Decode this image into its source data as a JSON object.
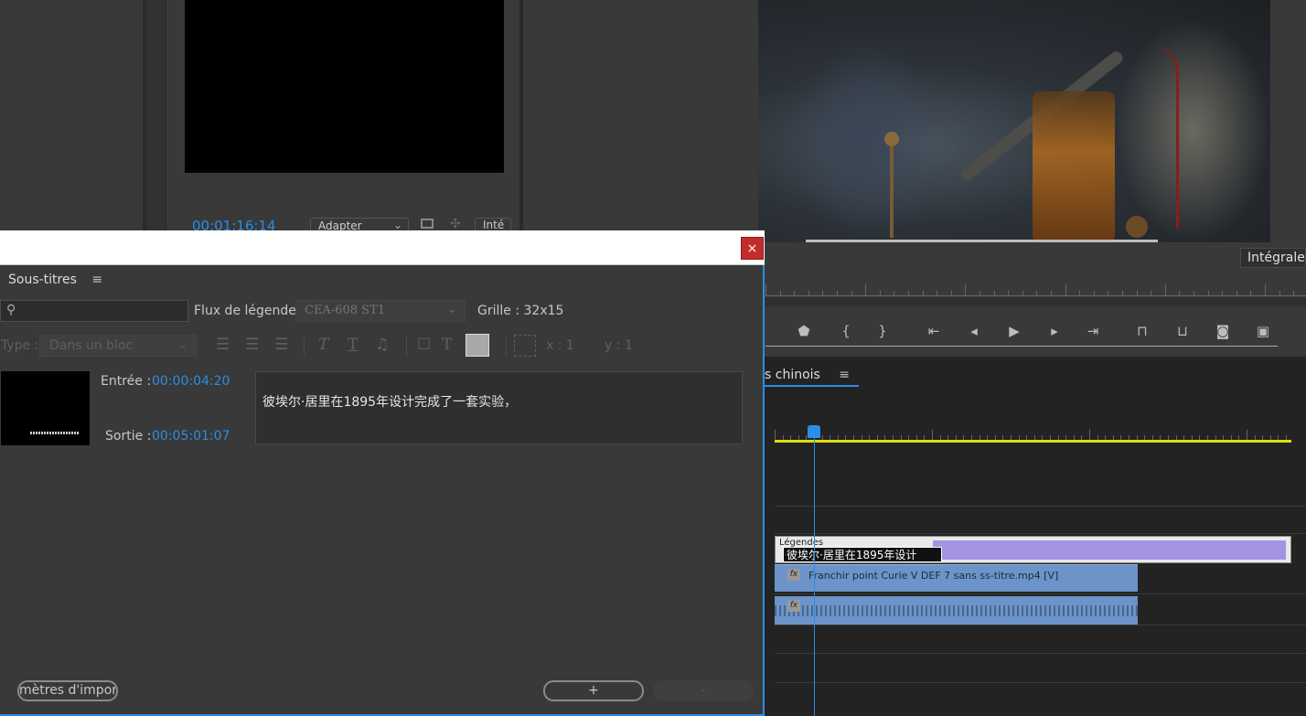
{
  "source_monitor": {
    "timecode": "00:01:16:14",
    "fit_value": "Adapter",
    "quality_value": "Inté"
  },
  "program_monitor": {
    "quality_value": "Intégrale"
  },
  "transport": {
    "buttons": [
      "marker-icon",
      "mark-in-icon",
      "mark-out-icon",
      "go-to-in-icon",
      "step-back-icon",
      "play-icon",
      "step-forward-icon",
      "go-to-out-icon",
      "lift-icon",
      "extract-icon",
      "export-frame-icon",
      "button-editor-icon"
    ]
  },
  "timeline": {
    "tab_label": "s chinois",
    "menu_icon": "≡",
    "caption_track_label": "Légendes",
    "caption_clip_text": "彼埃尔·居里在1895年设计",
    "video_clip_name": "Franchir point Curie V DEF 7 sans ss-titre.mp4 [V]",
    "fx_label": "fx"
  },
  "captions_window": {
    "close_label": "×",
    "panel_title": "Sous-titres",
    "menu_icon": "≡",
    "search_icon": "⚲",
    "flux_label": "Flux de légende :",
    "flux_value": "CEA-608 ST1",
    "grille_label": "Grille :  32x15",
    "type_label": "Type :",
    "type_value": "Dans un bloc",
    "x_label": "x :  1",
    "y_label": "y :  1",
    "entree_label": "Entrée :",
    "entree_value": "00:00:04:20",
    "sortie_label": "Sortie :",
    "sortie_value": "00:05:01:07",
    "caption_text": "彼埃尔·居里在1895年设计完成了一套实验，",
    "import_button": "mètres d'importa",
    "add_button": "+",
    "remove_button": "-"
  },
  "colors": {
    "accent_blue": "#2b8de5",
    "caption_bar": "#a594e4",
    "clip_blue": "#6c94c8",
    "work_area": "#dede12",
    "close_red": "#c42b2b"
  }
}
